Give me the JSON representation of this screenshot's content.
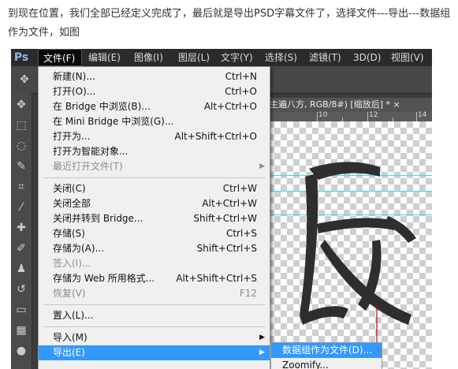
{
  "caption": "到现在位置，我们全部已经定义完成了，最后就是导出PSD字幕文件了，选择文件---导出---数据组作为文件，如图",
  "app": {
    "logo": "Ps"
  },
  "menubar": [
    {
      "label": "文件(F)",
      "active": true
    },
    {
      "label": "编辑(E)"
    },
    {
      "label": "图像(I)"
    },
    {
      "label": "图层(L)"
    },
    {
      "label": "文字(Y)"
    },
    {
      "label": "选择(S)"
    },
    {
      "label": "滤镜(T)"
    },
    {
      "label": "3D(D)"
    },
    {
      "label": "视图(V)"
    }
  ],
  "document": {
    "tab_label": "主遍八方, RGB/8#) [缩放后] *  ×",
    "ruler_labels": [
      "10",
      "12",
      "14"
    ]
  },
  "file_menu": [
    {
      "label": "新建(N)...",
      "shortcut": "Ctrl+N"
    },
    {
      "label": "打开(O)...",
      "shortcut": "Ctrl+O"
    },
    {
      "label": "在 Bridge 中浏览(B)...",
      "shortcut": "Alt+Ctrl+O"
    },
    {
      "label": "在 Mini Bridge 中浏览(G)...",
      "shortcut": ""
    },
    {
      "label": "打开为...",
      "shortcut": "Alt+Shift+Ctrl+O"
    },
    {
      "label": "打开为智能对象...",
      "shortcut": ""
    },
    {
      "label": "最近打开文件(T)",
      "shortcut": "",
      "submenu": true,
      "disabled": true
    },
    {
      "separator": true
    },
    {
      "label": "关闭(C)",
      "shortcut": "Ctrl+W"
    },
    {
      "label": "关闭全部",
      "shortcut": "Alt+Ctrl+W"
    },
    {
      "label": "关闭并转到 Bridge...",
      "shortcut": "Shift+Ctrl+W"
    },
    {
      "label": "存储(S)",
      "shortcut": "Ctrl+S"
    },
    {
      "label": "存储为(A)...",
      "shortcut": "Shift+Ctrl+S"
    },
    {
      "label": "签入(I)...",
      "shortcut": "",
      "disabled": true
    },
    {
      "label": "存储为 Web 所用格式...",
      "shortcut": "Alt+Shift+Ctrl+S"
    },
    {
      "label": "恢复(V)",
      "shortcut": "F12",
      "disabled": true
    },
    {
      "separator": true
    },
    {
      "label": "置入(L)...",
      "shortcut": ""
    },
    {
      "separator": true
    },
    {
      "label": "导入(M)",
      "shortcut": "",
      "submenu": true
    },
    {
      "label": "导出(E)",
      "shortcut": "",
      "submenu": true,
      "selected": true
    }
  ],
  "export_submenu": [
    {
      "label": "数据组作为文件(D)...",
      "selected": true
    },
    {
      "label": "Zoomify..."
    }
  ]
}
